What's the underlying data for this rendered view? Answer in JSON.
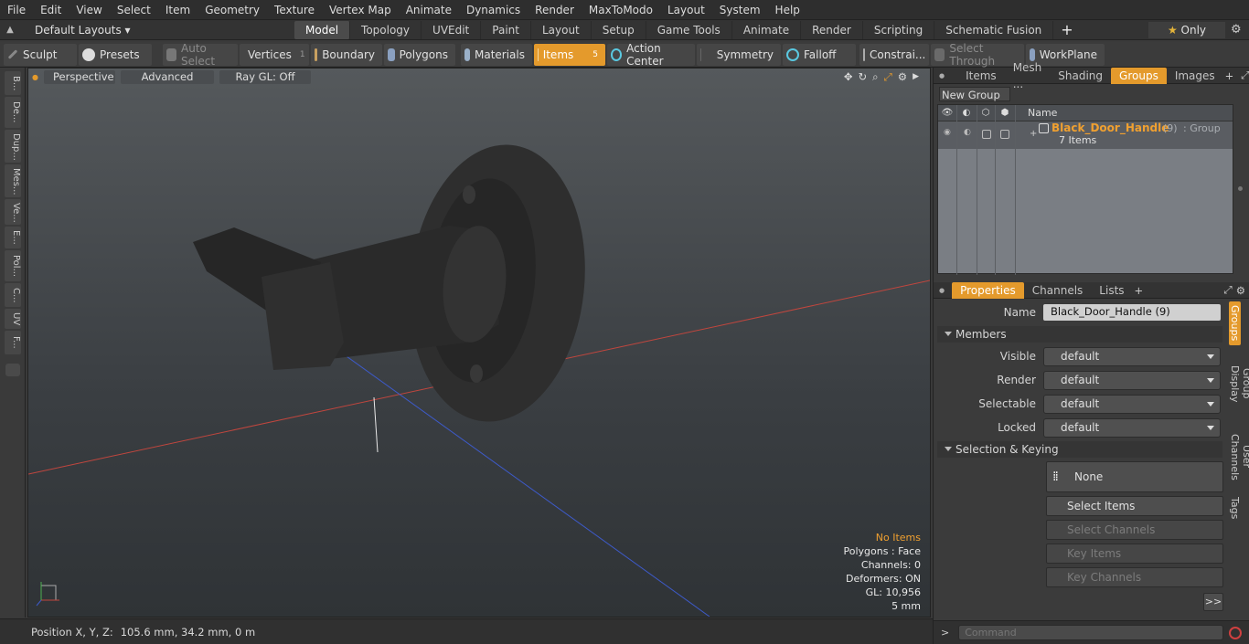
{
  "menubar": [
    "File",
    "Edit",
    "View",
    "Select",
    "Item",
    "Geometry",
    "Texture",
    "Vertex Map",
    "Animate",
    "Dynamics",
    "Render",
    "MaxToModo",
    "Layout",
    "System",
    "Help"
  ],
  "layout": {
    "selector": "Default Layouts",
    "tabs": [
      "Model",
      "Topology",
      "UVEdit",
      "Paint",
      "Layout",
      "Setup",
      "Game Tools",
      "Animate",
      "Render",
      "Scripting",
      "Schematic Fusion"
    ],
    "active_tab": "Model",
    "only_label": "Only"
  },
  "toolbar": {
    "sculpt": "Sculpt",
    "presets": "Presets",
    "auto_select": "Auto Select",
    "vertices": "Vertices",
    "vertices_count": "1",
    "boundary": "Boundary",
    "polygons": "Polygons",
    "materials": "Materials",
    "items": "Items",
    "items_count": "5",
    "action_center": "Action Center",
    "symmetry": "Symmetry",
    "falloff": "Falloff",
    "constrain": "Constrai...",
    "select_through": "Select Through",
    "workplane": "WorkPlane"
  },
  "left_tools": [
    "B...",
    "De...",
    "Dup...",
    "Mes...",
    "Ve...",
    "E...",
    "Pol...",
    "C...",
    "UV",
    "F..."
  ],
  "viewport": {
    "perspective": "Perspective",
    "advanced": "Advanced",
    "raygl": "Ray GL: Off",
    "hud": {
      "no_items": "No Items",
      "polygons": "Polygons : Face",
      "channels": "Channels: 0",
      "deformers": "Deformers: ON",
      "gl": "GL: 10,956",
      "scale": "5 mm"
    }
  },
  "status": {
    "position_label": "Position X, Y, Z:",
    "position_value": "105.6 mm, 34.2 mm, 0 m"
  },
  "groups_panel": {
    "tabs": [
      "Items",
      "Mesh ...",
      "Shading",
      "Groups",
      "Images"
    ],
    "active_tab": "Groups",
    "new_group": "New Group",
    "col_name": "Name",
    "group_name": "Black_Door_Handle",
    "group_count": "(9)",
    "group_type": ": Group",
    "group_items": "7 Items"
  },
  "properties": {
    "tabs": [
      "Properties",
      "Channels",
      "Lists"
    ],
    "active_tab": "Properties",
    "name_label": "Name",
    "name_value": "Black_Door_Handle (9)",
    "members": "Members",
    "visible_label": "Visible",
    "visible_value": "default",
    "render_label": "Render",
    "render_value": "default",
    "selectable_label": "Selectable",
    "selectable_value": "default",
    "locked_label": "Locked",
    "locked_value": "default",
    "selection_keying": "Selection & Keying",
    "none": "None",
    "select_items": "Select Items",
    "select_channels": "Select Channels",
    "key_items": "Key Items",
    "key_channels": "Key Channels",
    "more": ">>",
    "side_tabs": [
      "Groups",
      "Group Display",
      "User Channels",
      "Tags"
    ]
  },
  "command": {
    "placeholder": "Command",
    "prompt": ">"
  },
  "colors": {
    "accent": "#e49a2c",
    "group_name": "#f0a030"
  }
}
